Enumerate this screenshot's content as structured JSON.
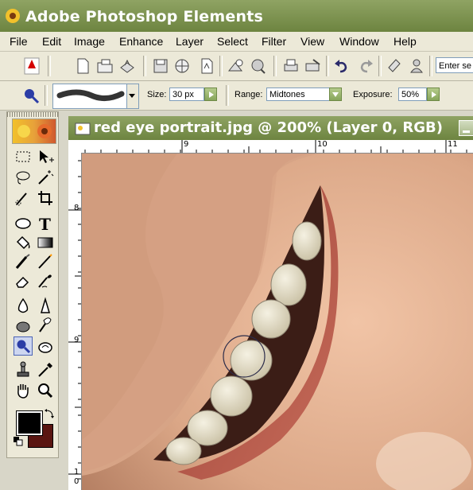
{
  "app": {
    "title": "Adobe Photoshop Elements"
  },
  "menu": [
    "File",
    "Edit",
    "Image",
    "Enhance",
    "Layer",
    "Select",
    "Filter",
    "View",
    "Window",
    "Help"
  ],
  "toolbar": {
    "search_value": "Enter se",
    "icons": [
      "adobe-logo-icon",
      "new-file-icon",
      "open-file-icon",
      "browse-icon",
      "save-icon",
      "save-web-icon",
      "pdf-icon",
      "print-icon",
      "online-service-icon",
      "undo-icon",
      "redo-icon",
      "palette-icon",
      "help-icon"
    ]
  },
  "options": {
    "size_label": "Size:",
    "size_value": "30 px",
    "range_label": "Range:",
    "range_value": "Midtones",
    "exposure_label": "Exposure:",
    "exposure_value": "50%"
  },
  "document": {
    "title": "red eye portrait.jpg @ 200% (Layer 0, RGB)",
    "ruler_top": [
      "9",
      "10",
      "11"
    ],
    "ruler_left": [
      "8",
      "9",
      "1",
      "0"
    ]
  },
  "colors": {
    "foreground": "#000000",
    "background": "#5a1511",
    "accent_green": "#7a9049"
  }
}
